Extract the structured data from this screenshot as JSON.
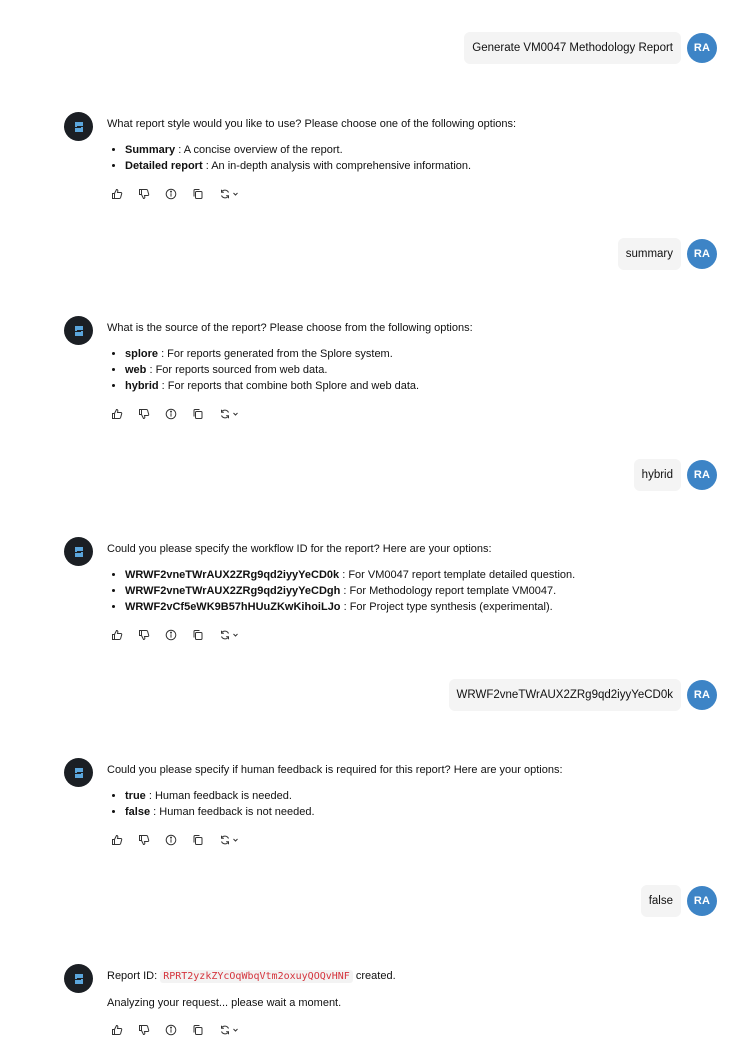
{
  "user": {
    "initials": "RA"
  },
  "messages": [
    {
      "role": "user",
      "text": "Generate VM0047 Methodology Report"
    },
    {
      "role": "bot",
      "intro": "What report style would you like to use? Please choose one of the following options:",
      "options": [
        {
          "key": "Summary",
          "desc": " : A concise overview of the report."
        },
        {
          "key": "Detailed report",
          "desc": " : An in-depth analysis with comprehensive information."
        }
      ]
    },
    {
      "role": "user",
      "text": "summary"
    },
    {
      "role": "bot",
      "intro": "What is the source of the report? Please choose from the following options:",
      "options": [
        {
          "key": "splore",
          "desc": " : For reports generated from the Splore system."
        },
        {
          "key": "web",
          "desc": " : For reports sourced from web data."
        },
        {
          "key": "hybrid",
          "desc": " : For reports that combine both Splore and web data."
        }
      ]
    },
    {
      "role": "user",
      "text": "hybrid"
    },
    {
      "role": "bot",
      "intro": "Could you please specify the workflow ID for the report? Here are your options:",
      "options": [
        {
          "key": "WRWF2vneTWrAUX2ZRg9qd2iyyYeCD0k",
          "desc": " : For VM0047 report template detailed question."
        },
        {
          "key": "WRWF2vneTWrAUX2ZRg9qd2iyyYeCDgh",
          "desc": " : For Methodology report template VM0047."
        },
        {
          "key": "WRWF2vCf5eWK9B57hHUuZKwKihoiLJo",
          "desc": " : For Project type synthesis (experimental)."
        }
      ]
    },
    {
      "role": "user",
      "text": "WRWF2vneTWrAUX2ZRg9qd2iyyYeCD0k"
    },
    {
      "role": "bot",
      "intro": "Could you please specify if human feedback is required for this report? Here are your options:",
      "options": [
        {
          "key": "true",
          "desc": " : Human feedback is needed."
        },
        {
          "key": "false",
          "desc": " : Human feedback is not needed."
        }
      ]
    },
    {
      "role": "user",
      "text": "false"
    },
    {
      "role": "bot",
      "report_prefix": "Report ID: ",
      "report_id": "RPRT2yzkZYcOqWbqVtm2oxuyQOQvHNF",
      "report_suffix": " created.",
      "status": "Analyzing your request... please wait a moment."
    }
  ],
  "icons": [
    "thumbs-up-icon",
    "thumbs-down-icon",
    "info-icon",
    "copy-icon",
    "regenerate-icon"
  ],
  "colors": {
    "avatar": "#3d84c6",
    "bot_avatar": "#1b1f24",
    "code": "#d4333c",
    "bubble": "#f4f4f4"
  }
}
